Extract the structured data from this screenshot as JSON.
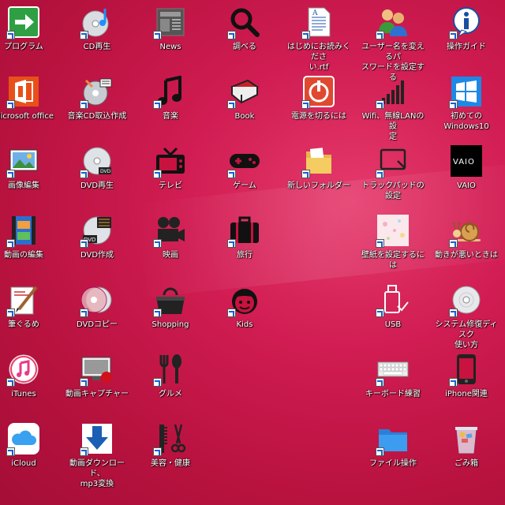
{
  "desktop": {
    "icons": [
      {
        "label": "プログラム",
        "icon": "green-arrow-icon"
      },
      {
        "label": "CD再生",
        "icon": "cd-music-icon"
      },
      {
        "label": "News",
        "icon": "newspaper-icon"
      },
      {
        "label": "調べる",
        "icon": "magnifier-icon"
      },
      {
        "label": "はじめにお読みくださ\nい.rtf",
        "icon": "document-icon"
      },
      {
        "label": "ユーザー名を変えるパ\nスワードを設定する",
        "icon": "users-icon"
      },
      {
        "label": "操作ガイド",
        "icon": "info-icon"
      },
      {
        "label": "Microsoft office",
        "icon": "office-icon"
      },
      {
        "label": "音楽CD取込作成",
        "icon": "cd-rip-icon"
      },
      {
        "label": "音楽",
        "icon": "music-note-icon"
      },
      {
        "label": "Book",
        "icon": "book-icon"
      },
      {
        "label": "電源を切るには",
        "icon": "power-icon"
      },
      {
        "label": "Wifi、無線LANの設\n定",
        "icon": "wifi-signal-icon"
      },
      {
        "label": "初めての\nWindows10",
        "icon": "windows-icon"
      },
      {
        "label": "画像編集",
        "icon": "image-edit-icon"
      },
      {
        "label": "DVD再生",
        "icon": "dvd-icon"
      },
      {
        "label": "テレビ",
        "icon": "tv-icon"
      },
      {
        "label": "ゲーム",
        "icon": "gamepad-icon"
      },
      {
        "label": "新しいフォルダー",
        "icon": "folder-icon"
      },
      {
        "label": "トラックパッドの設定",
        "icon": "trackpad-icon"
      },
      {
        "label": "VAIO",
        "icon": "vaio-icon"
      },
      {
        "label": "動画の編集",
        "icon": "film-edit-icon"
      },
      {
        "label": "DVD作成",
        "icon": "dvd-create-icon"
      },
      {
        "label": "映画",
        "icon": "movie-camera-icon"
      },
      {
        "label": "旅行",
        "icon": "suitcase-icon"
      },
      {
        "label": "壁紙を設定するには",
        "icon": "wallpaper-icon"
      },
      {
        "label": "動きが悪いときは",
        "icon": "snail-icon"
      },
      {
        "label": "筆ぐるめ",
        "icon": "brush-icon"
      },
      {
        "label": "DVDコピー",
        "icon": "dvd-copy-icon"
      },
      {
        "label": "Shopping",
        "icon": "shopping-bag-icon"
      },
      {
        "label": "Kids",
        "icon": "kid-face-icon"
      },
      {
        "label": "USB",
        "icon": "usb-icon"
      },
      {
        "label": "システム修復ディスク\n使い方",
        "icon": "disc-icon"
      },
      {
        "label": "iTunes",
        "icon": "itunes-icon"
      },
      {
        "label": "動画キャプチャー",
        "icon": "capture-icon"
      },
      {
        "label": "グルメ",
        "icon": "cutlery-icon"
      },
      {
        "label": "キーボード練習",
        "icon": "keyboard-icon"
      },
      {
        "label": "iPhone関連",
        "icon": "phone-icon"
      },
      {
        "label": "iCloud",
        "icon": "cloud-icon"
      },
      {
        "label": "動画ダウンロード、\nmp3変換",
        "icon": "download-icon"
      },
      {
        "label": "美容・健康",
        "icon": "scissors-icon"
      },
      {
        "label": "ファイル操作",
        "icon": "blue-folder-icon"
      },
      {
        "label": "ごみ箱",
        "icon": "recycle-bin-icon"
      }
    ]
  }
}
